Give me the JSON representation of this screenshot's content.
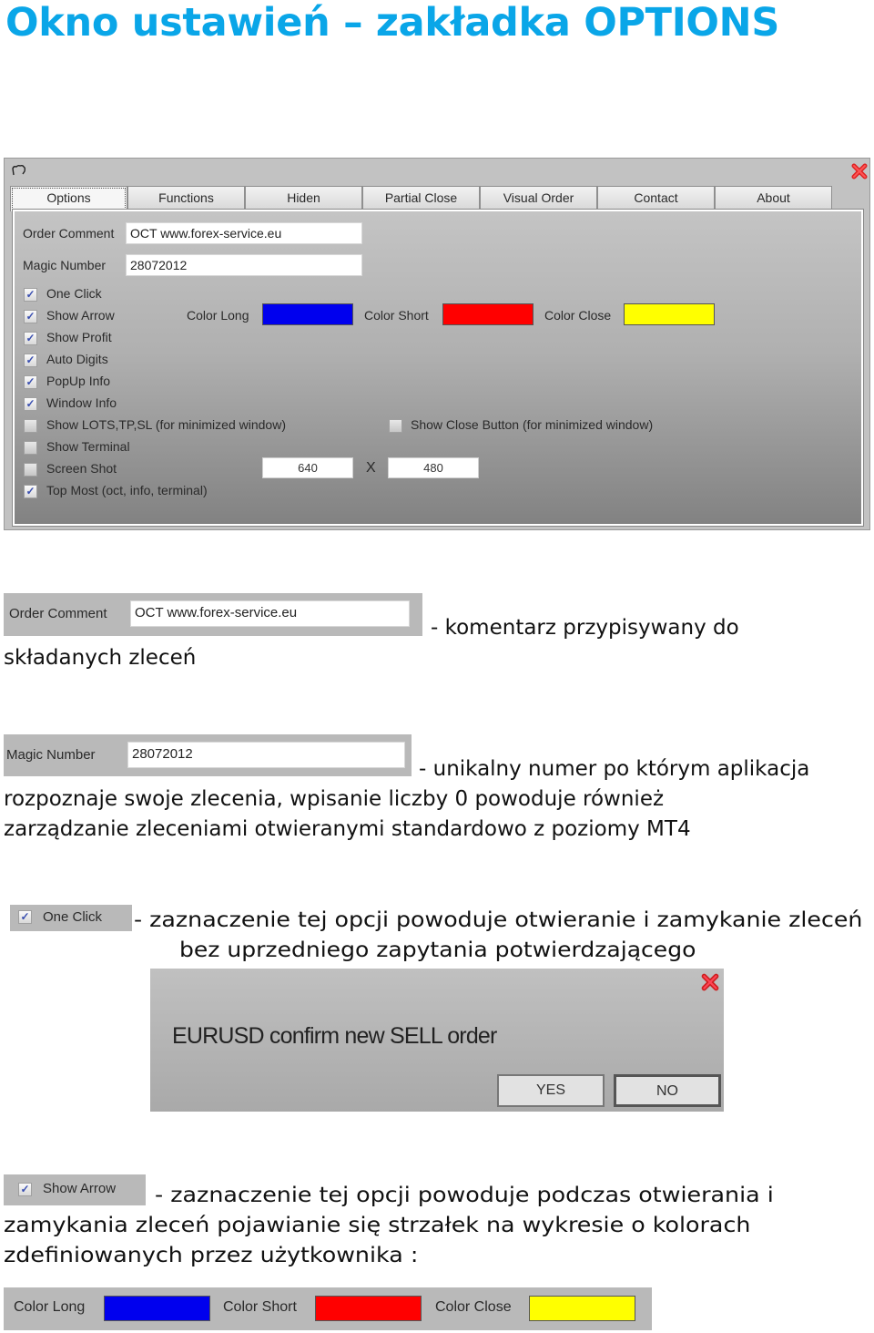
{
  "page_title": "Okno ustawień – zakładka OPTIONS",
  "window": {
    "tabs": [
      {
        "label": "Options",
        "active": true
      },
      {
        "label": "Functions"
      },
      {
        "label": "Hiden"
      },
      {
        "label": "Partial Close"
      },
      {
        "label": "Visual Order"
      },
      {
        "label": "Contact"
      },
      {
        "label": "About"
      }
    ],
    "order_comment_label": "Order Comment",
    "order_comment_value": "OCT www.forex-service.eu",
    "magic_number_label": "Magic Number",
    "magic_number_value": "28072012",
    "checkboxes": [
      {
        "label": "One Click",
        "checked": true
      },
      {
        "label": "Show Arrow",
        "checked": true
      },
      {
        "label": "Show Profit",
        "checked": true
      },
      {
        "label": "Auto Digits",
        "checked": true
      },
      {
        "label": "PopUp Info",
        "checked": true
      },
      {
        "label": "Window Info",
        "checked": true
      },
      {
        "label": "Show LOTS,TP,SL (for minimized window)",
        "checked": false
      },
      {
        "label": "Show Terminal",
        "checked": false
      },
      {
        "label": "Screen Shot",
        "checked": false
      },
      {
        "label": "Top Most (oct, info, terminal)",
        "checked": true
      }
    ],
    "show_close_button": {
      "label": "Show Close Button (for minimized window)",
      "checked": false
    },
    "colors": {
      "long_label": "Color Long",
      "long": "#0000ee",
      "short_label": "Color Short",
      "short": "#ff0000",
      "close_label": "Color Close",
      "close": "#ffff00"
    },
    "screenshot_width": "640",
    "screenshot_x": "X",
    "screenshot_height": "480",
    "check_glyph": "✓"
  },
  "sections": {
    "order_comment": {
      "label": "Order Comment",
      "value": "OCT www.forex-service.eu",
      "desc_line1": "- komentarz przypisywany do",
      "desc_line2": "składanych zleceń"
    },
    "magic_number": {
      "label": "Magic Number",
      "value": "28072012",
      "desc_line1": "- unikalny numer po którym aplikacja",
      "desc_line2": "rozpoznaje swoje zlecenia, wpisanie liczby 0 powoduje również",
      "desc_line3": "zarządzanie zleceniami otwieranymi standardowo z poziomy MT4"
    },
    "one_click": {
      "label": "One Click",
      "desc_line1": "- zaznaczenie tej opcji powoduje otwieranie i zamykanie zleceń",
      "desc_line2": "bez uprzedniego zapytania potwierdzającego"
    },
    "confirm_dialog": {
      "message": "EURUSD confirm new SELL order",
      "yes": "YES",
      "no": "NO"
    },
    "show_arrow": {
      "label": "Show Arrow",
      "desc_line1": "- zaznaczenie tej opcji powoduje podczas otwierania i",
      "desc_line2": "zamykania zleceń pojawianie się strzałek na wykresie o kolorach",
      "desc_line3": "zdefiniowanych przez użytkownika :"
    },
    "colors_bar": {
      "long_label": "Color Long",
      "short_label": "Color Short",
      "close_label": "Color Close"
    }
  }
}
